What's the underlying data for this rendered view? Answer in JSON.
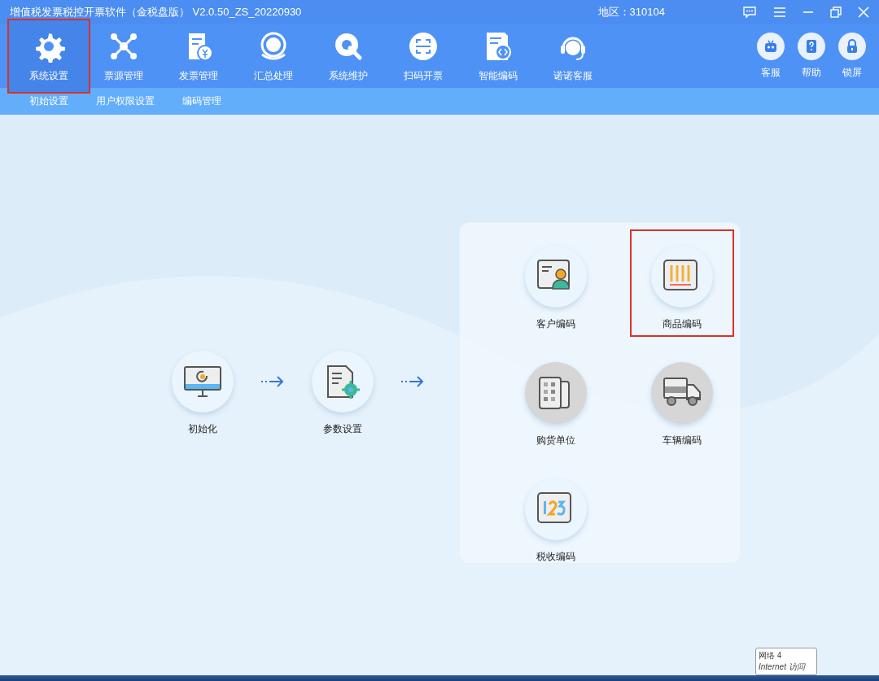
{
  "window": {
    "title": "增值税发票税控开票软件（金税盘版） V2.0.50_ZS_20220930",
    "region": "地区：310104"
  },
  "toolbar": [
    {
      "label": "系统设置",
      "selected": true,
      "highlighted": true
    },
    {
      "label": "票源管理",
      "selected": false,
      "highlighted": false
    },
    {
      "label": "发票管理",
      "selected": false,
      "highlighted": false
    },
    {
      "label": "汇总处理",
      "selected": false,
      "highlighted": false
    },
    {
      "label": "系统维护",
      "selected": false,
      "highlighted": false
    },
    {
      "label": "扫码开票",
      "selected": false,
      "highlighted": false
    },
    {
      "label": "智能编码",
      "selected": false,
      "highlighted": false
    },
    {
      "label": "诺诺客服",
      "selected": false,
      "highlighted": false
    }
  ],
  "quick_buttons": [
    {
      "label": "客服"
    },
    {
      "label": "帮助"
    },
    {
      "label": "锁屏"
    }
  ],
  "subnav": [
    {
      "label": "初始设置"
    },
    {
      "label": "用户权限设置"
    },
    {
      "label": "编码管理"
    }
  ],
  "flow": [
    {
      "label": "初始化"
    },
    {
      "label": "参数设置"
    }
  ],
  "coding_panel": [
    {
      "label": "客户编码",
      "highlighted": false,
      "disabled": false
    },
    {
      "label": "商品编码",
      "highlighted": true,
      "disabled": false
    },
    {
      "label": "购货单位",
      "highlighted": false,
      "disabled": true
    },
    {
      "label": "车辆编码",
      "highlighted": false,
      "disabled": true
    },
    {
      "label": "税收编码",
      "highlighted": false,
      "disabled": false
    }
  ],
  "tooltip": {
    "line_1": "网络  4",
    "line_2": "Internet 访问"
  }
}
